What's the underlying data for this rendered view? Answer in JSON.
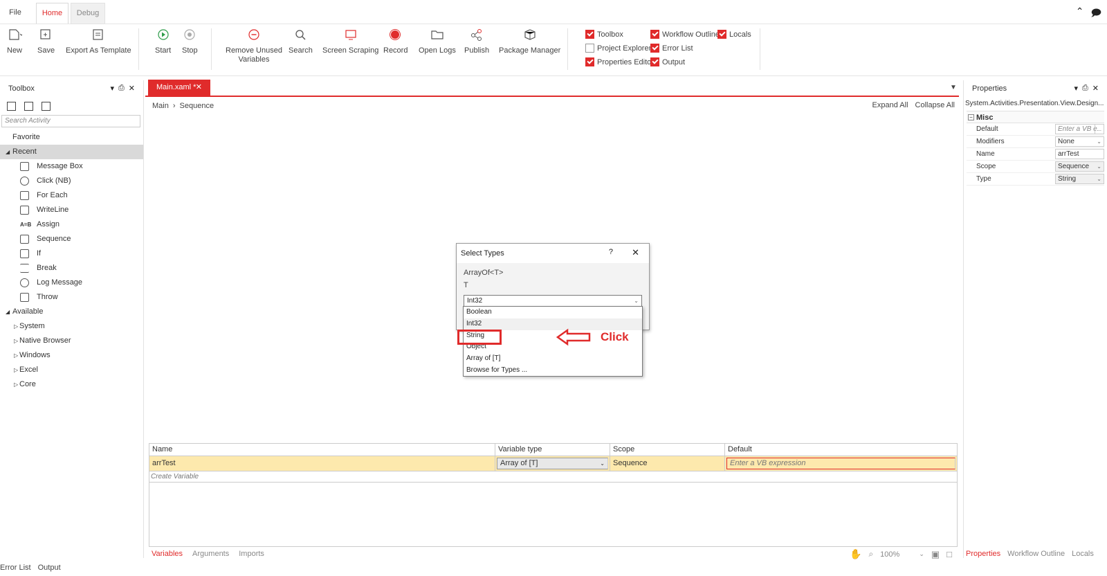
{
  "tabs": {
    "file": "File",
    "home": "Home",
    "debug": "Debug"
  },
  "ribbon": {
    "new": "New",
    "save": "Save",
    "export": "Export As Template",
    "start": "Start",
    "stop": "Stop",
    "remove1": "Remove Unused",
    "remove2": "Variables",
    "search": "Search",
    "scraping": "Screen Scraping",
    "record": "Record",
    "open_logs": "Open Logs",
    "publish": "Publish",
    "package": "Package Manager"
  },
  "checks": {
    "toolbox": "Toolbox",
    "project_explorer": "Project Explorer",
    "properties_editor": "Properties Editor",
    "workflow_outline": "Workflow Outline",
    "error_list": "Error List",
    "output": "Output",
    "locals": "Locals"
  },
  "toolbox": {
    "title": "Toolbox",
    "search_placeholder": "Search Activity",
    "favorite": "Favorite",
    "recent": "Recent",
    "recent_items": [
      "Message Box",
      "Click (NB)",
      "For Each",
      "WriteLine",
      "Assign",
      "Sequence",
      "If",
      "Break",
      "Log Message",
      "Throw"
    ],
    "available": "Available",
    "available_items": [
      "System",
      "Native Browser",
      "Windows",
      "Excel",
      "Core"
    ]
  },
  "designer": {
    "doc_tab": "Main.xaml *",
    "breadcrumb_main": "Main",
    "breadcrumb_sequence": "Sequence",
    "expand_all": "Expand All",
    "collapse_all": "Collapse All"
  },
  "dialog": {
    "title": "Select Types",
    "help": "?",
    "generic": "ArrayOf<T>",
    "param": "T",
    "selected": "Int32",
    "options": [
      "Boolean",
      "Int32",
      "String",
      "Object",
      "Array of [T]",
      "Browse for Types ..."
    ]
  },
  "annotation": {
    "click": "Click"
  },
  "variables": {
    "headers": [
      "Name",
      "Variable type",
      "Scope",
      "Default"
    ],
    "row": {
      "name": "arrTest",
      "type": "Array of [T]",
      "scope": "Sequence",
      "default": "Enter a VB expression"
    },
    "create": "Create Variable",
    "tabs": [
      "Variables",
      "Arguments",
      "Imports"
    ],
    "zoom": "100%"
  },
  "properties": {
    "title": "Properties",
    "subtitle": "System.Activities.Presentation.View.Design...",
    "group": "Misc",
    "rows": [
      {
        "name": "Default",
        "value": "Enter a VB e"
      },
      {
        "name": "Modifiers",
        "value": "None"
      },
      {
        "name": "Name",
        "value": "arrTest"
      },
      {
        "name": "Scope",
        "value": "Sequence"
      },
      {
        "name": "Type",
        "value": "String"
      }
    ],
    "tabs": [
      "Properties",
      "Workflow Outline",
      "Locals"
    ]
  },
  "status": {
    "error_list": "Error List",
    "output": "Output"
  },
  "colors": {
    "accent": "#e02b2b",
    "highlight_row": "#fde9ad"
  }
}
